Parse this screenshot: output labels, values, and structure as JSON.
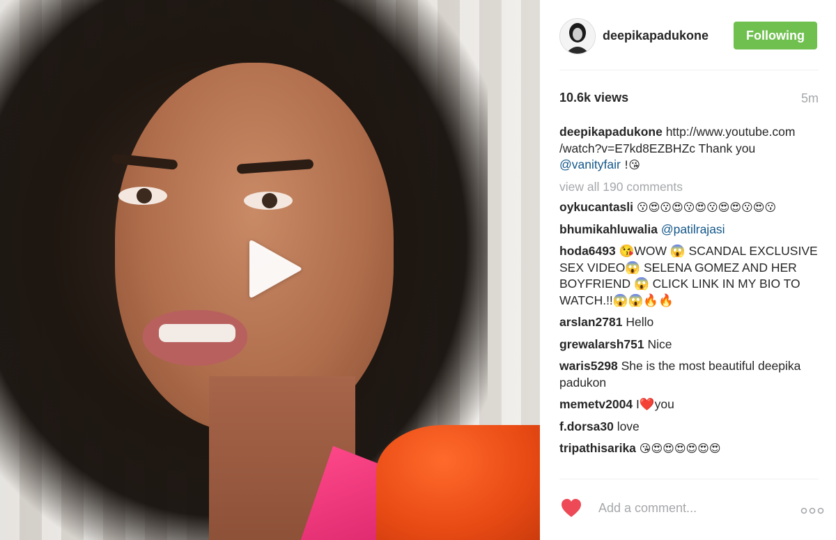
{
  "post": {
    "username": "deepikapadukone",
    "follow_label": "Following",
    "views": "10.6k views",
    "time_ago": "5m"
  },
  "caption": {
    "username": "deepikapadukone",
    "text": "http://www.youtube.com /watch?v=E7kd8EZBHZc Thank you",
    "mention": "@vanityfair",
    "suffix": " !😘"
  },
  "view_all": "view all 190 comments",
  "comments": [
    {
      "user": "oykucantasli",
      "text": "😗😍😗😍😗😍😗😍😍😗😍😗"
    },
    {
      "user": "bhumikahluwalia",
      "mention": "@patilrajasi"
    },
    {
      "user": "hoda6493",
      "text": "😘WOW 😱 SCANDAL EXCLUSIVE SEX VIDEO😱 SELENA GOMEZ AND HER BOYFRIEND 😱 CLICK LINK IN MY BIO TO WATCH.!!😱😱🔥🔥"
    },
    {
      "user": "arslan2781",
      "text": "Hello"
    },
    {
      "user": "grewalarsh751",
      "text": "Nice"
    },
    {
      "user": "waris5298",
      "text": "She is the most beautiful deepika padukon"
    },
    {
      "user": "memetv2004",
      "text": "I❤️you"
    },
    {
      "user": "f.dorsa30",
      "text": "love"
    },
    {
      "user": "tripathisarika",
      "text": "😘😍😍😍😍😍😍"
    }
  ],
  "footer": {
    "comment_placeholder": "Add a comment..."
  },
  "icons": {
    "play": "play-icon",
    "like": "heart-icon",
    "more": "more-options-icon"
  },
  "colors": {
    "follow_green": "#70c050",
    "mention_blue": "#125688",
    "muted_gray": "#a5a7aa",
    "heart_red": "#ed4956"
  }
}
